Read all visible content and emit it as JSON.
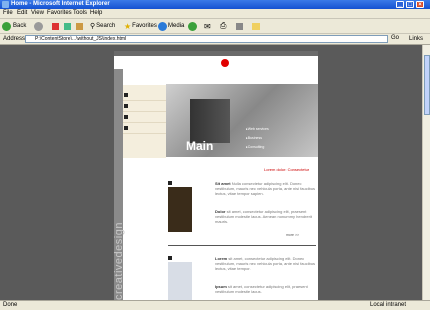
{
  "window": {
    "title": "Home - Microsoft Internet Explorer"
  },
  "menu": [
    "File",
    "Edit",
    "View",
    "Favorites",
    "Tools",
    "Help"
  ],
  "toolbar": {
    "back": "Back",
    "search": "Search",
    "favorites": "Favorites",
    "media": "Media"
  },
  "address": {
    "label": "Address",
    "url": "P:\\ContentStore\\...\\without_JS\\index.html",
    "go": "Go",
    "links": "Links"
  },
  "site": {
    "vertical_text": "creativedesign",
    "hero_title": "Main",
    "hero_links": [
      "Web services",
      "Business",
      "Consulting"
    ],
    "top_right_text": "Lorem dolor: Consectetur",
    "section1": {
      "para1_bold": "Sit amet",
      "para1": "Nulla consectetur adipiscing elit. Donec vestibulum, mauris nec vehicula porta, ante nisi faucibus lectus, vitae tempor sapien.",
      "para2_bold": "Dolor",
      "para2": "sit amet, consectetur adipiscing elit, praesent vestibulum molestie lacus. Aenean nonummy hendrerit mauris.",
      "more": "more >>"
    },
    "section2": {
      "para1_bold": "Lorem",
      "para1": "sit amet, consectetur adipiscing elit. Donec vestibulum, mauris nec vehicula porta, ante nisi faucibus lectus, vitae tempor.",
      "para2_bold": "Ipsum",
      "para2": "sit amet, consectetur adipiscing elit, praesent vestibulum molestie lacus.",
      "more": "more >>"
    }
  },
  "status": {
    "left": "Done",
    "right": "Local intranet"
  }
}
